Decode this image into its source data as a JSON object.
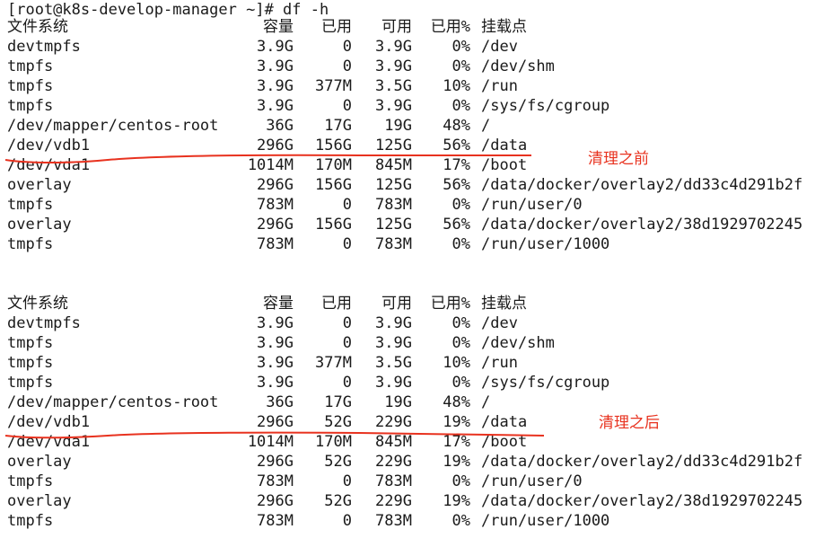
{
  "prompt": "[root@k8s-develop-manager ~]# df -h",
  "headers": [
    "文件系统",
    "容量",
    "已用",
    "可用",
    "已用%",
    "挂载点"
  ],
  "before": {
    "rows": [
      [
        "devtmpfs",
        "3.9G",
        "0",
        "3.9G",
        "0%",
        "/dev"
      ],
      [
        "tmpfs",
        "3.9G",
        "0",
        "3.9G",
        "0%",
        "/dev/shm"
      ],
      [
        "tmpfs",
        "3.9G",
        "377M",
        "3.5G",
        "10%",
        "/run"
      ],
      [
        "tmpfs",
        "3.9G",
        "0",
        "3.9G",
        "0%",
        "/sys/fs/cgroup"
      ],
      [
        "/dev/mapper/centos-root",
        "36G",
        "17G",
        "19G",
        "48%",
        "/"
      ],
      [
        "/dev/vdb1",
        "296G",
        "156G",
        "125G",
        "56%",
        "/data"
      ],
      [
        "/dev/vda1",
        "1014M",
        "170M",
        "845M",
        "17%",
        "/boot"
      ],
      [
        "overlay",
        "296G",
        "156G",
        "125G",
        "56%",
        "/data/docker/overlay2/dd33c4d291b2f"
      ],
      [
        "tmpfs",
        "783M",
        "0",
        "783M",
        "0%",
        "/run/user/0"
      ],
      [
        "overlay",
        "296G",
        "156G",
        "125G",
        "56%",
        "/data/docker/overlay2/38d1929702245"
      ],
      [
        "tmpfs",
        "783M",
        "0",
        "783M",
        "0%",
        "/run/user/1000"
      ]
    ]
  },
  "after": {
    "rows": [
      [
        "devtmpfs",
        "3.9G",
        "0",
        "3.9G",
        "0%",
        "/dev"
      ],
      [
        "tmpfs",
        "3.9G",
        "0",
        "3.9G",
        "0%",
        "/dev/shm"
      ],
      [
        "tmpfs",
        "3.9G",
        "377M",
        "3.5G",
        "10%",
        "/run"
      ],
      [
        "tmpfs",
        "3.9G",
        "0",
        "3.9G",
        "0%",
        "/sys/fs/cgroup"
      ],
      [
        "/dev/mapper/centos-root",
        "36G",
        "17G",
        "19G",
        "48%",
        "/"
      ],
      [
        "/dev/vdb1",
        "296G",
        "52G",
        "229G",
        "19%",
        "/data"
      ],
      [
        "/dev/vda1",
        "1014M",
        "170M",
        "845M",
        "17%",
        "/boot"
      ],
      [
        "overlay",
        "296G",
        "52G",
        "229G",
        "19%",
        "/data/docker/overlay2/dd33c4d291b2f"
      ],
      [
        "tmpfs",
        "783M",
        "0",
        "783M",
        "0%",
        "/run/user/0"
      ],
      [
        "overlay",
        "296G",
        "52G",
        "229G",
        "19%",
        "/data/docker/overlay2/38d1929702245"
      ],
      [
        "tmpfs",
        "783M",
        "0",
        "783M",
        "0%",
        "/run/user/1000"
      ]
    ]
  },
  "annotations": {
    "before_label": "清理之前",
    "after_label": "清理之后"
  },
  "colors": {
    "annotation": "#e8321f",
    "highlight_row": "#e9e9f7",
    "text": "#1a1a1a"
  }
}
